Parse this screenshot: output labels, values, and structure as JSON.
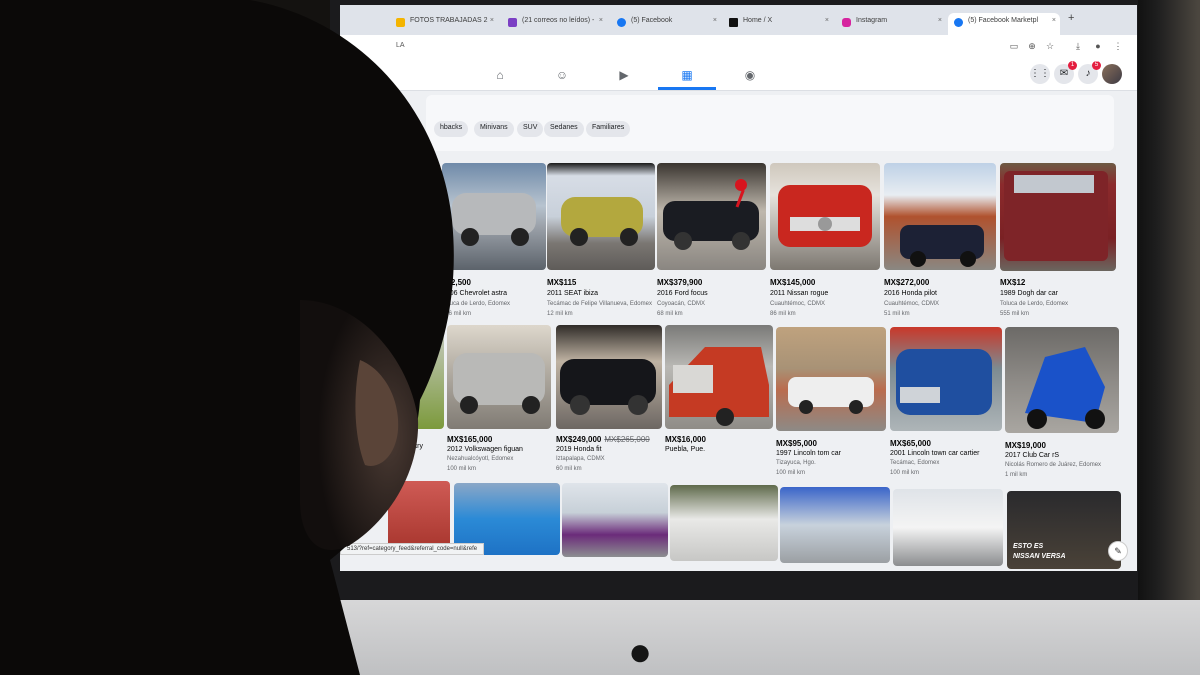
{
  "browser": {
    "tabs": [
      {
        "label": "FOTOS TRABAJADAS 2",
        "favicon": "drive-icon",
        "color": "#f4b400"
      },
      {
        "label": "(21 correos no leídos) -",
        "favicon": "mail-icon",
        "color": "#7b3fc4"
      },
      {
        "label": "(5) Facebook",
        "favicon": "facebook-icon",
        "color": "#1877f2"
      },
      {
        "label": "Home / X",
        "favicon": "x-icon",
        "color": "#111111"
      },
      {
        "label": "Instagram",
        "favicon": "instagram-icon",
        "color": "#d6249f"
      },
      {
        "label": "(5) Facebook Marketpl",
        "favicon": "facebook-icon",
        "color": "#1877f2"
      }
    ],
    "new_tab": "+",
    "url_fragment": "LA"
  },
  "facebook": {
    "accent": "#1877f2",
    "messenger_badge": "1",
    "notifications_badge": "5"
  },
  "filters": [
    "hbacks",
    "Minivans",
    "SUV",
    "Sedanes",
    "Familiares"
  ],
  "listings": [
    {
      "price": "$42,500",
      "title": "2006 Chevrolet astra",
      "location": "Toluca de Lerdo, Edomex",
      "mileage": "186 mil km"
    },
    {
      "price": "MX$115",
      "title": "2011 SEAT ibiza",
      "location": "Tecámac de Felipe Villanueva, Edomex",
      "mileage": "12 mil km"
    },
    {
      "price": "MX$379,900",
      "title": "2016 Ford focus",
      "location": "Coyoacán, CDMX",
      "mileage": "68 mil km"
    },
    {
      "price": "MX$145,000",
      "title": "2011 Nissan rogue",
      "location": "Cuauhtémoc, CDMX",
      "mileage": "86 mil km"
    },
    {
      "price": "MX$272,000",
      "title": "2016 Honda pilot",
      "location": "Cuauhtémoc, CDMX",
      "mileage": "51 mil km"
    },
    {
      "price": "MX$12",
      "title": "1989 Dogh dar car",
      "location": "Toluca de Lerdo, Edomex",
      "mileage": "555 mil km"
    },
    {
      "price": "",
      "title": "country",
      "location": "",
      "mileage": ""
    },
    {
      "price": "MX$165,000",
      "title": "2012 Volkswagen figuan",
      "location": "Nezahualcóyotl, Edomex",
      "mileage": "100 mil km"
    },
    {
      "price": "MX$249,000",
      "old_price": "MX$265,000",
      "title": "2019 Honda fit",
      "location": "Iztapalapa, CDMX",
      "mileage": "60 mil km"
    },
    {
      "price": "MX$16,000",
      "title": "Puebla, Pue.",
      "location": "",
      "mileage": ""
    },
    {
      "price": "MX$95,000",
      "title": "1997 Lincoln tom car",
      "location": "Tizayuca, Hgo.",
      "mileage": "100 mil km"
    },
    {
      "price": "MX$65,000",
      "title": "2001 Lincoln town car cartier",
      "location": "Tecámac, Edomex",
      "mileage": "100 mil km"
    },
    {
      "price": "MX$19,000",
      "title": "2017 Club Car rS",
      "location": "Nicolás Romero de Juárez, Edomex",
      "mileage": "1 mil km"
    }
  ],
  "status_url": "513/?ref=category_feed&referral_code=null&refe",
  "ad_text": {
    "line1": "ESTO ES",
    "line2": "NISSAN VERSA"
  }
}
